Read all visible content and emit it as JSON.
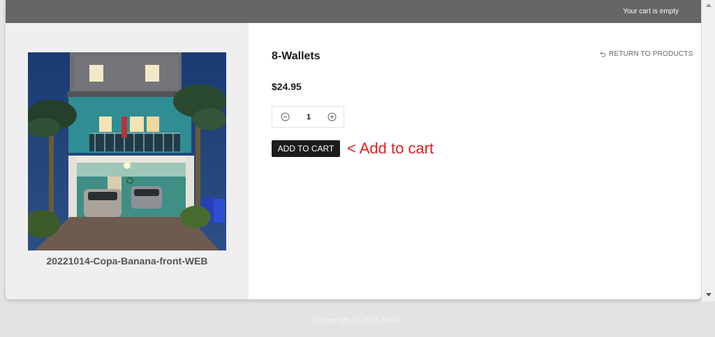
{
  "header": {
    "cart_status": "Your cart is empty"
  },
  "product": {
    "name": "8-Wallets",
    "price": "$24.95",
    "quantity": "1",
    "image_caption": "20221014-Copa-Banana-front-WEB",
    "add_to_cart_label": "ADD TO CART",
    "return_label": "RETURN TO PRODUCTS"
  },
  "annotation": {
    "text": "< Add to cart",
    "color": "#e02020"
  },
  "footer": {
    "copyright": "Copyright © 2025 MVP"
  },
  "icons": {
    "return": "return-arrow-icon",
    "decrement": "minus-circle-icon",
    "increment": "plus-circle-icon"
  },
  "colors": {
    "topbar": "#666666",
    "button": "#1c1c1c",
    "left_panel": "#efefef"
  }
}
